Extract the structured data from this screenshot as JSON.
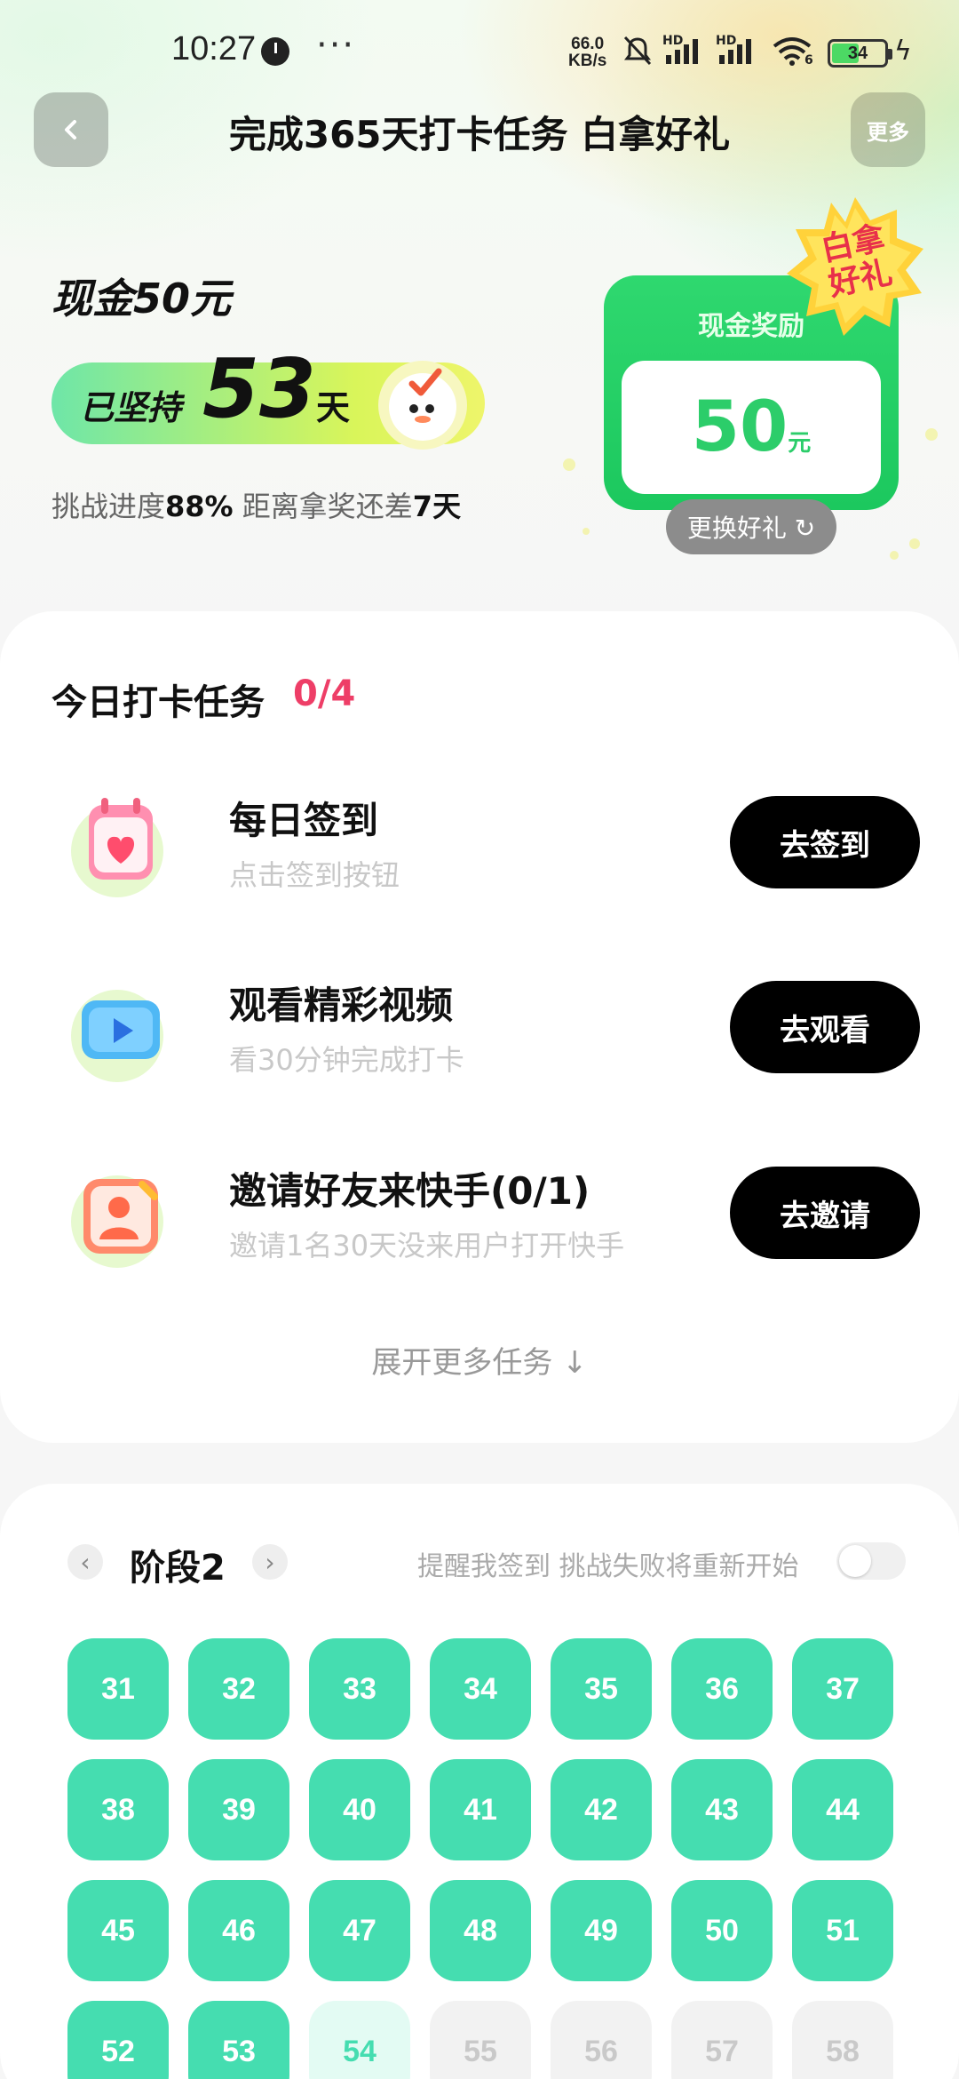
{
  "status_bar": {
    "time": "10:27",
    "dots": "···",
    "net_speed_value": "66.0",
    "net_speed_unit": "KB/s",
    "signal_label_1": "HD",
    "signal_label_2": "HD",
    "wifi_sub": "6",
    "battery": "34"
  },
  "nav": {
    "title": "完成365天打卡任务 白拿好礼",
    "more_label": "更多"
  },
  "hero": {
    "reward_label": "现金50元",
    "streak_prefix": "已坚持",
    "streak_days": "53",
    "streak_unit": "天",
    "progress_prefix": "挑战进度",
    "progress_percent": "88%",
    "progress_middle": " 距离拿奖还差",
    "days_left": "7天",
    "card_title": "现金奖励",
    "card_amount": "50",
    "card_unit": "元",
    "badge_line1": "白拿",
    "badge_line2": "好礼",
    "swap_label": "更换好礼 ↻"
  },
  "tasks": {
    "title": "今日打卡任务",
    "count": "0/4",
    "items": [
      {
        "name": "每日签到",
        "desc": "点击签到按钮",
        "button": "去签到",
        "icon": "calendar-heart-icon"
      },
      {
        "name": "观看精彩视频",
        "desc": "看30分钟完成打卡",
        "button": "去观看",
        "icon": "video-play-icon"
      },
      {
        "name": "邀请好友来快手(0/1)",
        "desc": "邀请1名30天没来用户打开快手",
        "button": "去邀请",
        "icon": "invite-friend-icon"
      }
    ],
    "expand_label": "展开更多任务 ↓"
  },
  "stage": {
    "label": "阶段2",
    "prev": "‹",
    "next": "›",
    "remind_text": "提醒我签到 挑战失败将重新开始",
    "days": [
      {
        "n": "31",
        "state": "done"
      },
      {
        "n": "32",
        "state": "done"
      },
      {
        "n": "33",
        "state": "done"
      },
      {
        "n": "34",
        "state": "done"
      },
      {
        "n": "35",
        "state": "done"
      },
      {
        "n": "36",
        "state": "done"
      },
      {
        "n": "37",
        "state": "done"
      },
      {
        "n": "38",
        "state": "done"
      },
      {
        "n": "39",
        "state": "done"
      },
      {
        "n": "40",
        "state": "done"
      },
      {
        "n": "41",
        "state": "done"
      },
      {
        "n": "42",
        "state": "done"
      },
      {
        "n": "43",
        "state": "done"
      },
      {
        "n": "44",
        "state": "done"
      },
      {
        "n": "45",
        "state": "done"
      },
      {
        "n": "46",
        "state": "done"
      },
      {
        "n": "47",
        "state": "done"
      },
      {
        "n": "48",
        "state": "done"
      },
      {
        "n": "49",
        "state": "done"
      },
      {
        "n": "50",
        "state": "done"
      },
      {
        "n": "51",
        "state": "done"
      },
      {
        "n": "52",
        "state": "done"
      },
      {
        "n": "53",
        "state": "done"
      },
      {
        "n": "54",
        "state": "today"
      },
      {
        "n": "55",
        "state": "future"
      },
      {
        "n": "56",
        "state": "future"
      },
      {
        "n": "57",
        "state": "future"
      },
      {
        "n": "58",
        "state": "future"
      }
    ]
  },
  "colors": {
    "accent_green": "#45ddb0",
    "reward_green": "#2ccd6a",
    "count_red": "#ee3e67",
    "button_black": "#000000"
  }
}
